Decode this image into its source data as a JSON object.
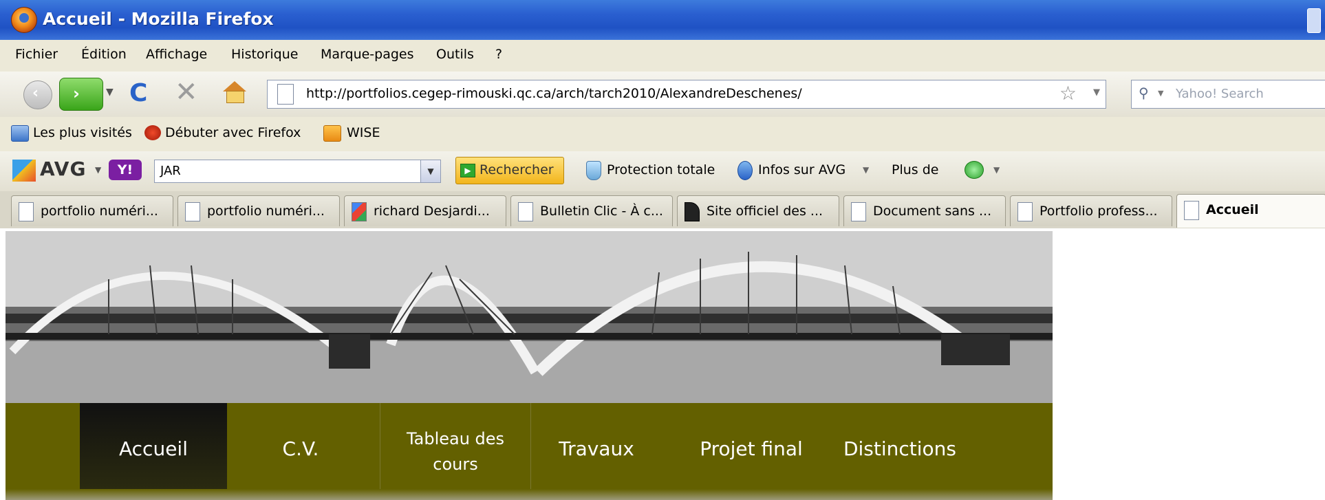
{
  "window": {
    "title": "Accueil - Mozilla Firefox"
  },
  "menubar": {
    "items": [
      "Fichier",
      "Édition",
      "Affichage",
      "Historique",
      "Marque-pages",
      "Outils",
      "?"
    ]
  },
  "navigation": {
    "url": "http://portfolios.cegep-rimouski.qc.ca/arch/tarch2010/AlexandreDeschenes/",
    "search_placeholder": "Yahoo! Search"
  },
  "bookmarks": [
    "Les plus visités",
    "Débuter avec Firefox",
    "WISE"
  ],
  "avg_toolbar": {
    "brand": "AVG",
    "yahoo_label": "Y!",
    "search_value": "JAR",
    "search_button": "Rechercher",
    "protection": "Protection totale",
    "infos": "Infos sur AVG",
    "plus": "Plus de"
  },
  "tabs": [
    {
      "title": "portfolio numéri..."
    },
    {
      "title": "portfolio numéri..."
    },
    {
      "title": "richard Desjardi..."
    },
    {
      "title": "Bulletin Clic - À c..."
    },
    {
      "title": "Site officiel des ..."
    },
    {
      "title": "Document sans ..."
    },
    {
      "title": "Portfolio profess..."
    },
    {
      "title": "Accueil",
      "active": true
    }
  ],
  "site_nav": {
    "items": [
      {
        "label": "Accueil",
        "active": true
      },
      {
        "label": "C.V."
      },
      {
        "label_line1": "Tableau des",
        "label_line2": "cours"
      },
      {
        "label": "Travaux"
      },
      {
        "label": "Projet final"
      },
      {
        "label": "Distinctions"
      }
    ],
    "color": "#636000"
  }
}
